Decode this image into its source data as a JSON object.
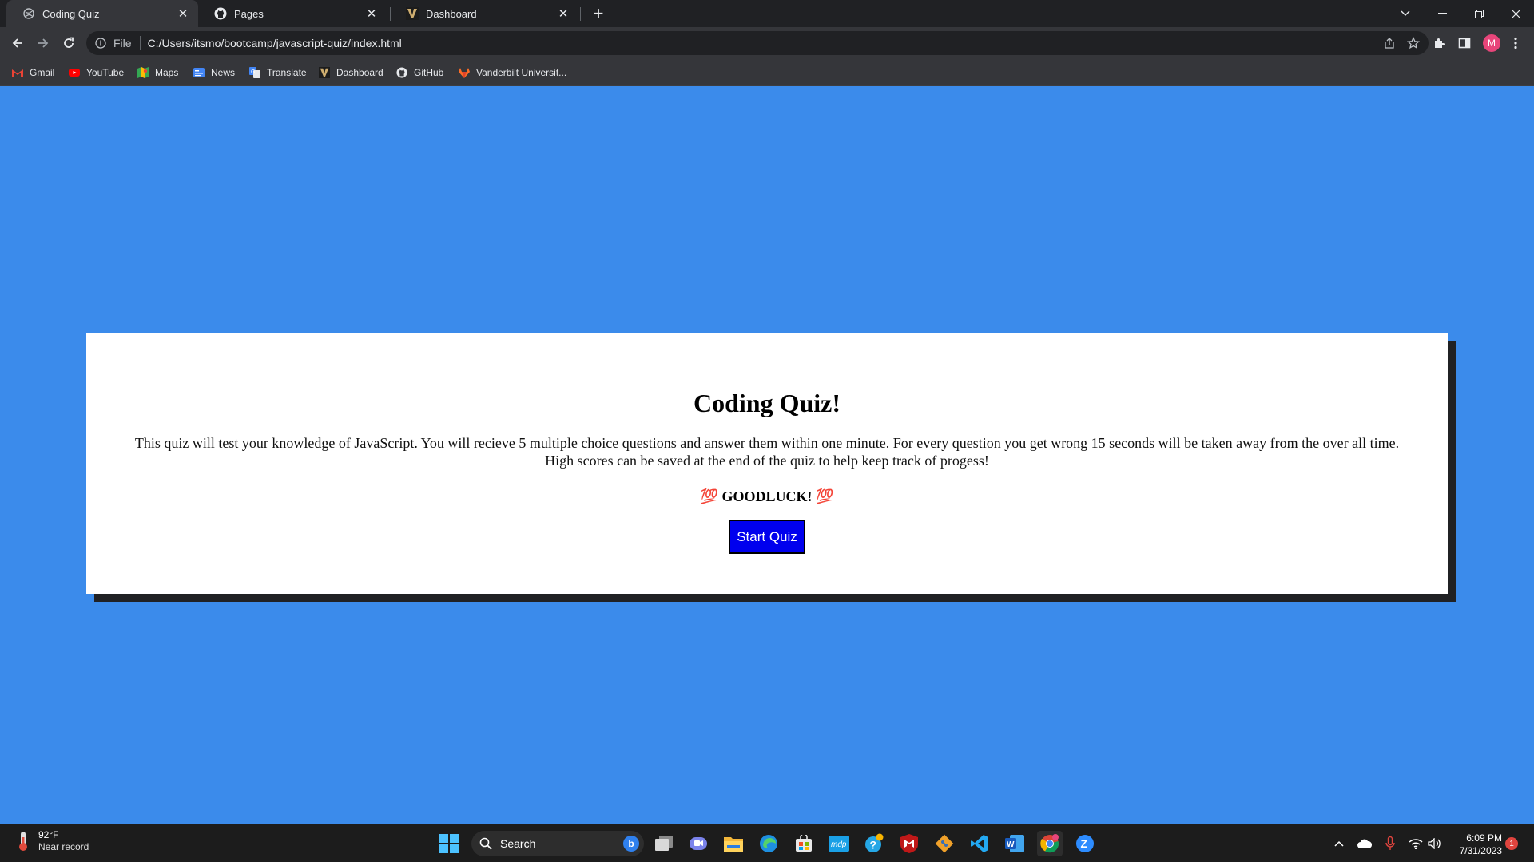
{
  "browser": {
    "tabs": [
      {
        "title": "Coding Quiz",
        "favicon": "globe-icon",
        "active": true
      },
      {
        "title": "Pages",
        "favicon": "github-icon",
        "active": false
      },
      {
        "title": "Dashboard",
        "favicon": "vanderbilt-v-icon",
        "active": false
      }
    ],
    "omnibox": {
      "scheme_label": "File",
      "url": "C:/Users/itsmo/bootcamp/javascript-quiz/index.html"
    },
    "profile_initial": "M",
    "bookmarks": [
      {
        "label": "Gmail",
        "icon": "gmail-icon"
      },
      {
        "label": "YouTube",
        "icon": "youtube-icon"
      },
      {
        "label": "Maps",
        "icon": "maps-icon"
      },
      {
        "label": "News",
        "icon": "news-icon"
      },
      {
        "label": "Translate",
        "icon": "translate-icon"
      },
      {
        "label": "Dashboard",
        "icon": "vanderbilt-v-icon"
      },
      {
        "label": "GitHub",
        "icon": "github-icon"
      },
      {
        "label": "Vanderbilt Universit...",
        "icon": "gitlab-icon"
      }
    ]
  },
  "page": {
    "background_color": "#3b8beb",
    "title": "Coding Quiz!",
    "description": "This quiz will test your knowledge of JavaScript. You will recieve 5 multiple choice questions and answer them within one minute. For every question you get wrong 15 seconds will be taken away from the over all time. High scores can be saved at the end of the quiz to help keep track of progess!",
    "goodluck": "💯 GOODLUCK! 💯",
    "start_button": "Start Quiz"
  },
  "taskbar": {
    "weather_temp": "92°F",
    "weather_condition": "Near record",
    "search_placeholder": "Search",
    "time": "6:09 PM",
    "date": "7/31/2023",
    "notification_count": "1",
    "pinned_apps": [
      "task-view-icon",
      "teams-chat-icon",
      "file-explorer-icon",
      "edge-icon",
      "microsoft-store-icon",
      "mdp-icon",
      "help-icon",
      "mcafee-icon",
      "git-icon",
      "vscode-icon",
      "word-icon",
      "chrome-icon",
      "zoom-icon"
    ]
  }
}
